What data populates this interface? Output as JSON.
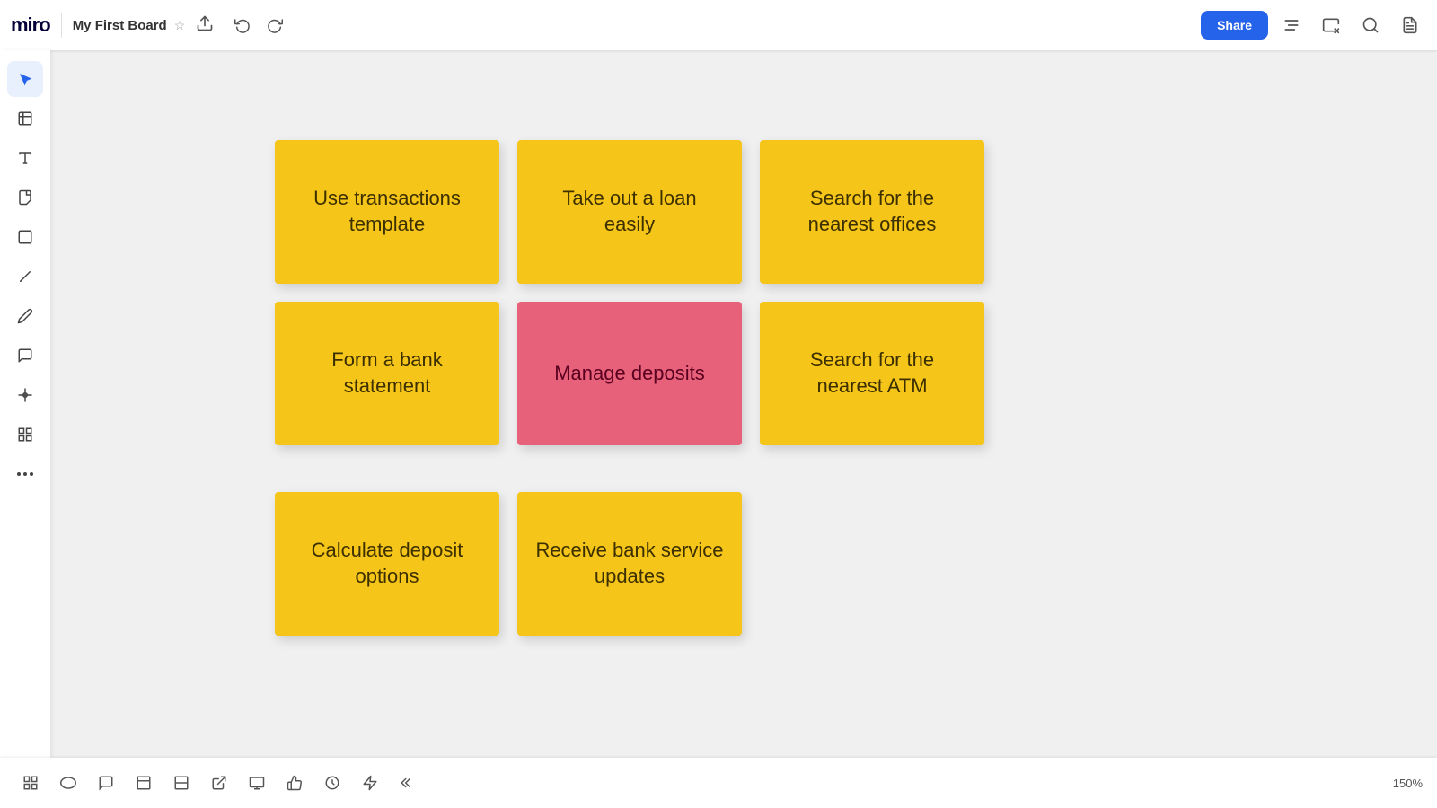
{
  "topbar": {
    "logo": "miro",
    "board_name": "My First Board",
    "share_label": "Share",
    "undo_label": "↩",
    "redo_label": "↪"
  },
  "notes": {
    "row1": [
      {
        "id": "note-transactions",
        "text": "Use transactions template",
        "color": "yellow"
      },
      {
        "id": "note-loan",
        "text": "Take out a loan easily",
        "color": "yellow"
      },
      {
        "id": "note-offices",
        "text": "Search for the nearest offices",
        "color": "yellow"
      }
    ],
    "row2": [
      {
        "id": "note-statement",
        "text": "Form a bank statement",
        "color": "yellow"
      },
      {
        "id": "note-deposits",
        "text": "Manage deposits",
        "color": "pink"
      },
      {
        "id": "note-atm",
        "text": "Search for the nearest ATM",
        "color": "yellow"
      }
    ],
    "row3": [
      {
        "id": "note-calc",
        "text": "Calculate deposit options",
        "color": "yellow"
      },
      {
        "id": "note-updates",
        "text": "Receive bank service updates",
        "color": "yellow"
      }
    ]
  },
  "zoom": "150%",
  "sidebar_items": [
    {
      "id": "cursor",
      "icon": "▲",
      "label": "cursor-icon",
      "active": true
    },
    {
      "id": "frames",
      "icon": "⬚",
      "label": "frames-icon"
    },
    {
      "id": "text",
      "icon": "T",
      "label": "text-icon"
    },
    {
      "id": "sticky",
      "icon": "▭",
      "label": "sticky-icon"
    },
    {
      "id": "shapes",
      "icon": "□",
      "label": "shapes-icon"
    },
    {
      "id": "pen",
      "icon": "/",
      "label": "pen-icon"
    },
    {
      "id": "pencil",
      "icon": "✏",
      "label": "pencil-icon"
    },
    {
      "id": "comment",
      "icon": "💬",
      "label": "comment-icon"
    },
    {
      "id": "crop",
      "icon": "⊕",
      "label": "crop-icon"
    },
    {
      "id": "chart",
      "icon": "▦",
      "label": "chart-icon"
    },
    {
      "id": "more",
      "icon": "···",
      "label": "more-icon"
    }
  ],
  "bottom_tools": [
    {
      "id": "grid",
      "icon": "⊞",
      "label": "grid-icon"
    },
    {
      "id": "ellipse",
      "icon": "⬭",
      "label": "ellipse-icon"
    },
    {
      "id": "chat",
      "icon": "💬",
      "label": "chat-icon"
    },
    {
      "id": "frame2",
      "icon": "⬚",
      "label": "frame2-icon"
    },
    {
      "id": "layout",
      "icon": "⊟",
      "label": "layout-icon"
    },
    {
      "id": "export",
      "icon": "↗",
      "label": "export-icon"
    },
    {
      "id": "presentation",
      "icon": "▭",
      "label": "presentation-icon"
    },
    {
      "id": "like",
      "icon": "👍",
      "label": "like-icon"
    },
    {
      "id": "timer",
      "icon": "◷",
      "label": "timer-icon"
    },
    {
      "id": "lightning",
      "icon": "⚡",
      "label": "lightning-icon"
    },
    {
      "id": "collapse",
      "icon": "«",
      "label": "collapse-icon"
    }
  ]
}
